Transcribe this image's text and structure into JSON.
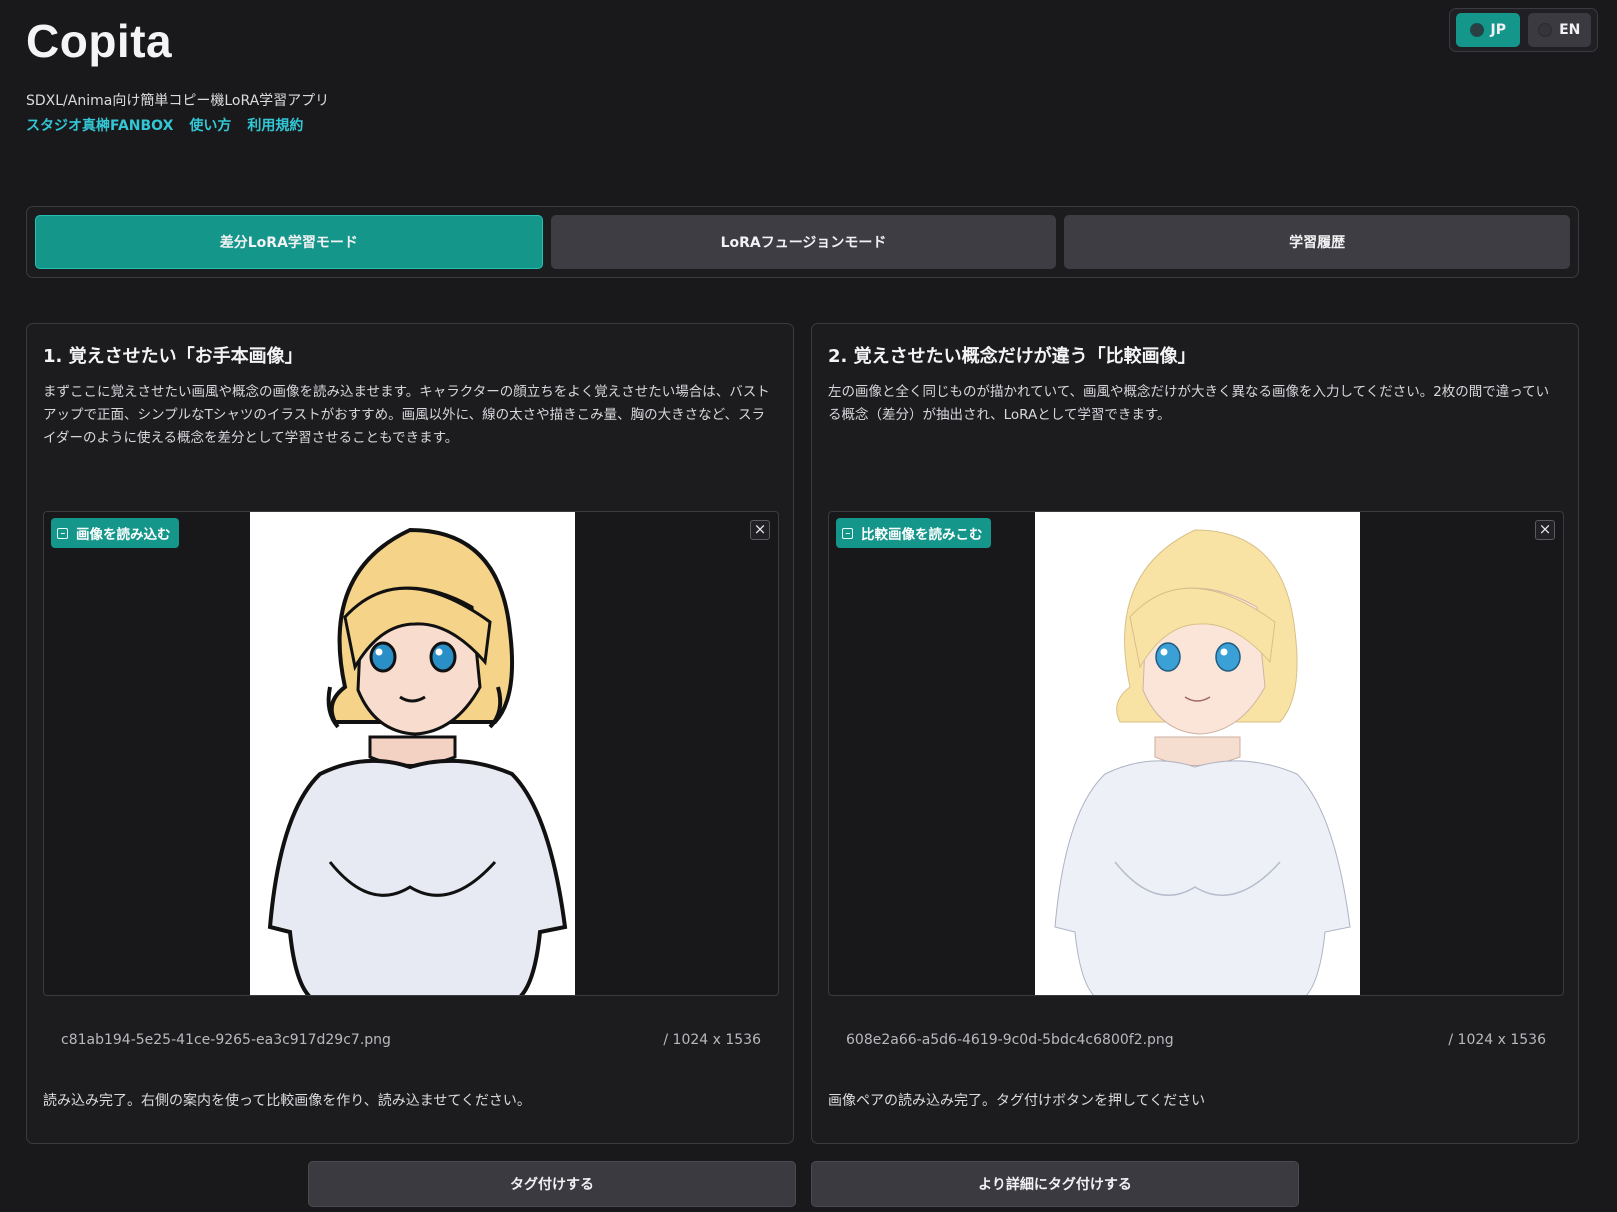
{
  "header": {
    "app_title": "Copita",
    "subtitle": "SDXL/Anima向け簡単コピー機LoRA学習アプリ",
    "links": [
      "スタジオ真榊FANBOX",
      "使い方",
      "利用規約"
    ],
    "link_color": "#33c7d6"
  },
  "language": {
    "options": [
      "JP",
      "EN"
    ],
    "selected": "JP"
  },
  "mode_tabs": {
    "tabs": [
      "差分LoRA学習モード",
      "LoRAフュージョンモード",
      "学習履歴"
    ],
    "active": "差分LoRA学習モード",
    "accent": "#14968b"
  },
  "panels": [
    {
      "heading": "1. 覚えさせたい「お手本画像」",
      "description": "まずここに覚えさせたい画風や概念の画像を読み込ませます。キャラクターの顔立ちをよく覚えさせたい場合は、バストアップで正面、シンプルなTシャツのイラストがおすすめ。画風以外に、線の太さや描きこみ量、胸の大きさなど、スライダーのように使える概念を差分として学習させることもできます。",
      "upload_label": "画像を読み込む",
      "upload_icon": "image-icon",
      "close_icon": "close-icon",
      "close_glyph": "×",
      "filename": "c81ab194-5e25-41ce-9265-ea3c917d29c7.png",
      "dimensions": "/ 1024 x 1536",
      "status": "読み込み完了。右側の案内を使って比較画像を作り、読み込ませてください。"
    },
    {
      "heading": "2. 覚えさせたい概念だけが違う「比較画像」",
      "description": "左の画像と全く同じものが描かれていて、画風や概念だけが大きく異なる画像を入力してください。2枚の間で違っている概念（差分）が抽出され、LoRAとして学習できます。",
      "upload_label": "比較画像を読みこむ",
      "upload_icon": "image-icon",
      "close_icon": "close-icon",
      "close_glyph": "×",
      "filename": "608e2a66-a5d6-4619-9c0d-5bdc4c6800f2.png",
      "dimensions": "/ 1024 x 1536",
      "status": "画像ペアの読み込み完了。タグ付けボタンを押してください"
    }
  ],
  "actions": {
    "tag_label": "タグ付けする",
    "tag_detailed_label": "より詳細にタグ付けする"
  }
}
